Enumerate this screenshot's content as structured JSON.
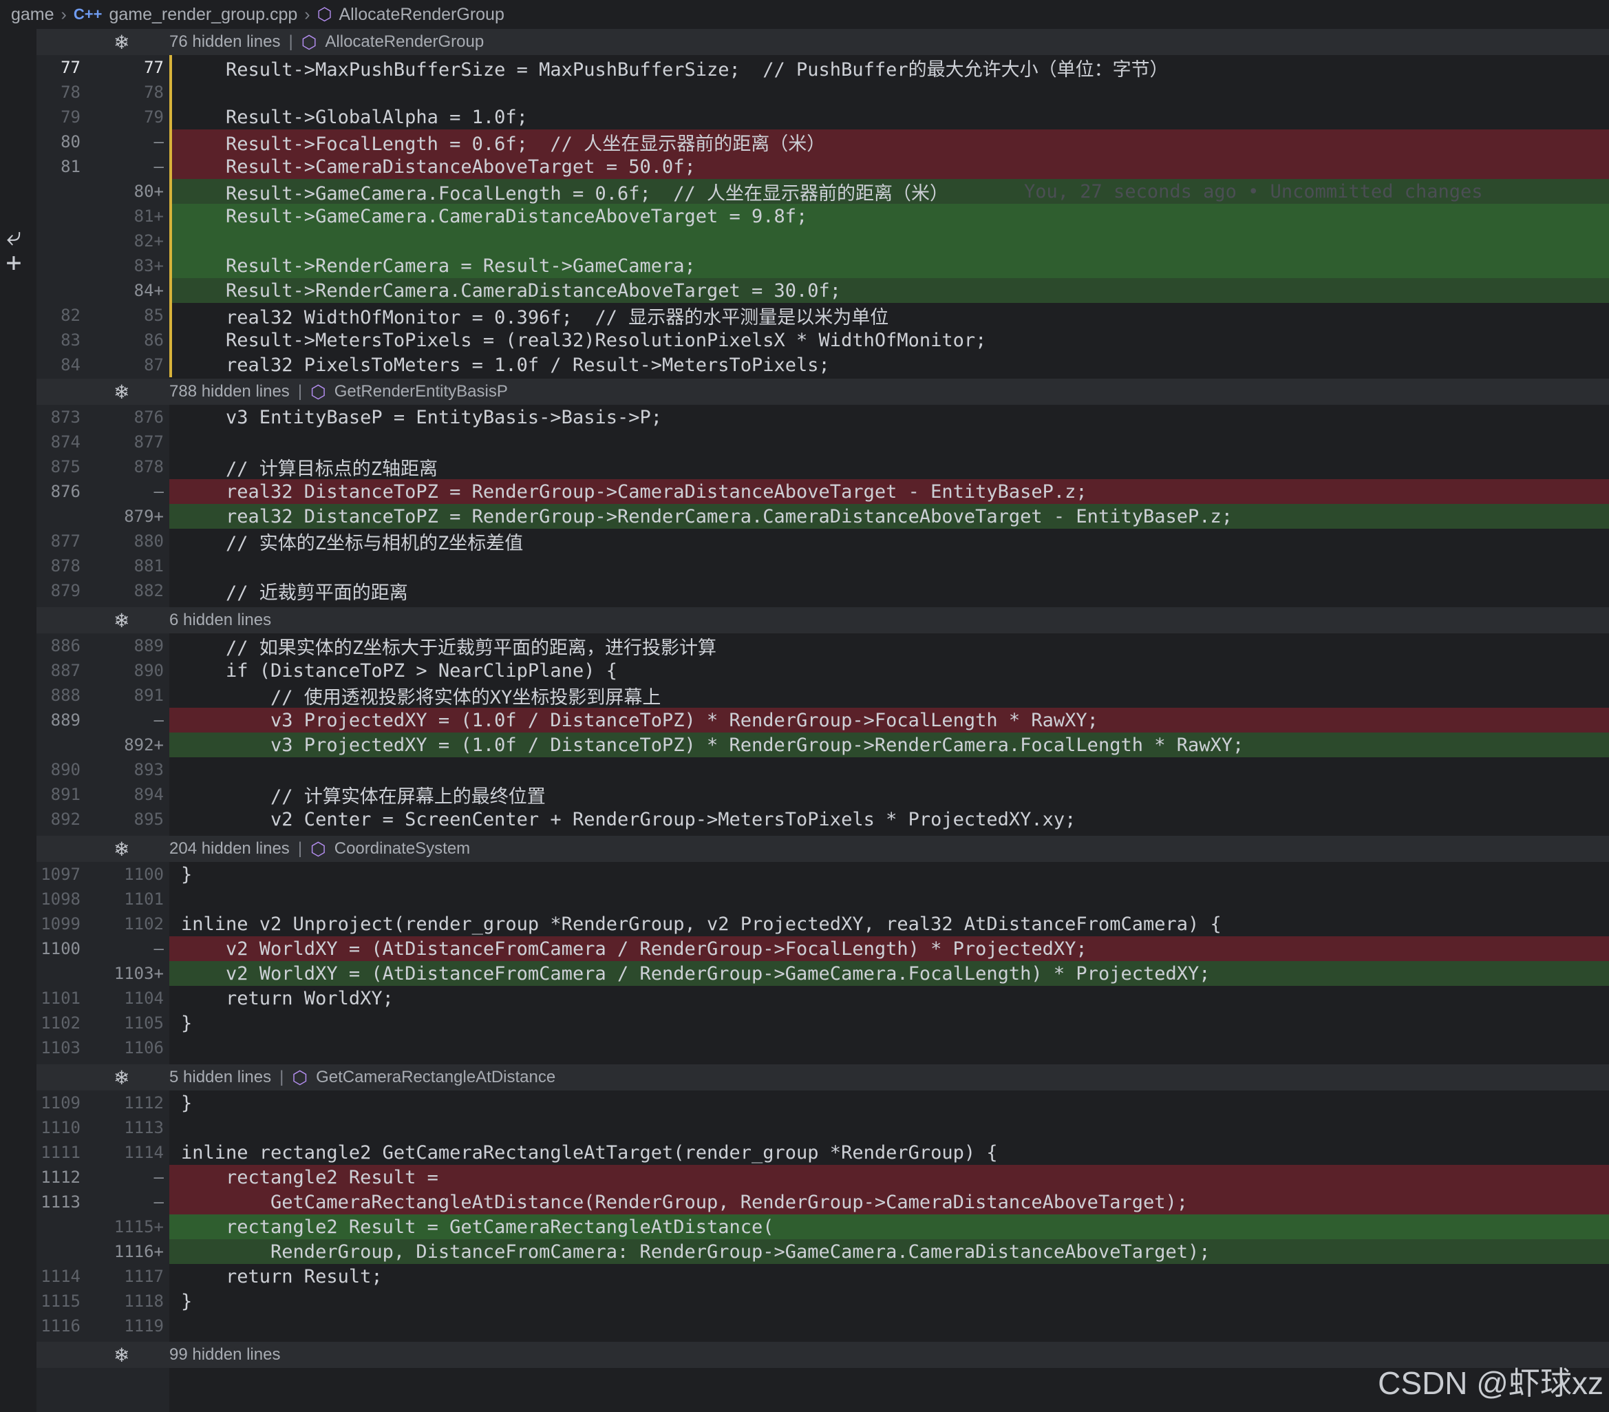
{
  "breadcrumb": {
    "folder": "game",
    "file_icon": "C++",
    "file": "game_render_group.cpp",
    "symbol": "AllocateRenderGroup"
  },
  "folds": [
    {
      "text": "76 hidden lines",
      "symbol": "AllocateRenderGroup"
    },
    {
      "text": "788 hidden lines",
      "symbol": "GetRenderEntityBasisP"
    },
    {
      "text": "6 hidden lines",
      "symbol": ""
    },
    {
      "text": "204 hidden lines",
      "symbol": "CoordinateSystem"
    },
    {
      "text": "5 hidden lines",
      "symbol": "GetCameraRectangleAtDistance"
    },
    {
      "text": "99 hidden lines",
      "symbol": ""
    }
  ],
  "lines": [
    {
      "old": "77",
      "new": "77",
      "type": "ctx",
      "text": "    Result->MaxPushBufferSize = MaxPushBufferSize;  // PushBuffer的最大允许大小（单位：字节）"
    },
    {
      "old": "78",
      "new": "78",
      "type": "ctx",
      "text": ""
    },
    {
      "old": "79",
      "new": "79",
      "type": "ctx",
      "text": "    Result->GlobalAlpha = 1.0f;"
    },
    {
      "old": "80",
      "new": "—",
      "type": "del",
      "text": "    Result->FocalLength = 0.6f;  // 人坐在显示器前的距离（米）"
    },
    {
      "old": "81",
      "new": "—",
      "type": "del",
      "text": "    Result->CameraDistanceAboveTarget = 50.0f;"
    },
    {
      "old": "",
      "new": "80+",
      "type": "add",
      "text": "    Result->GameCamera.FocalLength = 0.6f;  // 人坐在显示器前的距离（米）",
      "blame": "You, 27 seconds ago • Uncommitted changes"
    },
    {
      "old": "",
      "new": "81+",
      "type": "add-strong",
      "text": "    Result->GameCamera.CameraDistanceAboveTarget = 9.8f;"
    },
    {
      "old": "",
      "new": "82+",
      "type": "add-strong",
      "text": ""
    },
    {
      "old": "",
      "new": "83+",
      "type": "add-strong",
      "text": "    Result->RenderCamera = Result->GameCamera;"
    },
    {
      "old": "",
      "new": "84+",
      "type": "add",
      "text": "    Result->RenderCamera.CameraDistanceAboveTarget = 30.0f;"
    },
    {
      "old": "82",
      "new": "85",
      "type": "ctx",
      "text": "    real32 WidthOfMonitor = 0.396f;  // 显示器的水平测量是以米为单位"
    },
    {
      "old": "83",
      "new": "86",
      "type": "ctx",
      "text": "    Result->MetersToPixels = (real32)ResolutionPixelsX * WidthOfMonitor;"
    },
    {
      "old": "84",
      "new": "87",
      "type": "ctx",
      "text": "    real32 PixelsToMeters = 1.0f / Result->MetersToPixels;"
    },
    {
      "old": "873",
      "new": "876",
      "type": "ctx",
      "text": "    v3 EntityBaseP = EntityBasis->Basis->P;"
    },
    {
      "old": "874",
      "new": "877",
      "type": "ctx",
      "text": ""
    },
    {
      "old": "875",
      "new": "878",
      "type": "ctx",
      "text": "    // 计算目标点的Z轴距离"
    },
    {
      "old": "876",
      "new": "—",
      "type": "del",
      "text": "    real32 DistanceToPZ = RenderGroup->CameraDistanceAboveTarget - EntityBaseP.z;"
    },
    {
      "old": "",
      "new": "879+",
      "type": "add",
      "text": "    real32 DistanceToPZ = RenderGroup->RenderCamera.CameraDistanceAboveTarget - EntityBaseP.z;"
    },
    {
      "old": "877",
      "new": "880",
      "type": "ctx",
      "text": "    // 实体的Z坐标与相机的Z坐标差值"
    },
    {
      "old": "878",
      "new": "881",
      "type": "ctx",
      "text": ""
    },
    {
      "old": "879",
      "new": "882",
      "type": "ctx",
      "text": "    // 近裁剪平面的距离"
    },
    {
      "old": "886",
      "new": "889",
      "type": "ctx",
      "text": "    // 如果实体的Z坐标大于近裁剪平面的距离，进行投影计算"
    },
    {
      "old": "887",
      "new": "890",
      "type": "ctx",
      "text": "    if (DistanceToPZ > NearClipPlane) {"
    },
    {
      "old": "888",
      "new": "891",
      "type": "ctx",
      "text": "        // 使用透视投影将实体的XY坐标投影到屏幕上"
    },
    {
      "old": "889",
      "new": "—",
      "type": "del",
      "text": "        v3 ProjectedXY = (1.0f / DistanceToPZ) * RenderGroup->FocalLength * RawXY;"
    },
    {
      "old": "",
      "new": "892+",
      "type": "add",
      "text": "        v3 ProjectedXY = (1.0f / DistanceToPZ) * RenderGroup->RenderCamera.FocalLength * RawXY;"
    },
    {
      "old": "890",
      "new": "893",
      "type": "ctx",
      "text": ""
    },
    {
      "old": "891",
      "new": "894",
      "type": "ctx",
      "text": "        // 计算实体在屏幕上的最终位置"
    },
    {
      "old": "892",
      "new": "895",
      "type": "ctx",
      "text": "        v2 Center = ScreenCenter + RenderGroup->MetersToPixels * ProjectedXY.xy;"
    },
    {
      "old": "1097",
      "new": "1100",
      "type": "ctx",
      "text": "}"
    },
    {
      "old": "1098",
      "new": "1101",
      "type": "ctx",
      "text": ""
    },
    {
      "old": "1099",
      "new": "1102",
      "type": "ctx",
      "text": "inline v2 Unproject(render_group *RenderGroup, v2 ProjectedXY, real32 AtDistanceFromCamera) {"
    },
    {
      "old": "1100",
      "new": "—",
      "type": "del",
      "text": "    v2 WorldXY = (AtDistanceFromCamera / RenderGroup->FocalLength) * ProjectedXY;"
    },
    {
      "old": "",
      "new": "1103+",
      "type": "add",
      "text": "    v2 WorldXY = (AtDistanceFromCamera / RenderGroup->GameCamera.FocalLength) * ProjectedXY;"
    },
    {
      "old": "1101",
      "new": "1104",
      "type": "ctx",
      "text": "    return WorldXY;"
    },
    {
      "old": "1102",
      "new": "1105",
      "type": "ctx",
      "text": "}"
    },
    {
      "old": "1103",
      "new": "1106",
      "type": "ctx",
      "text": ""
    },
    {
      "old": "1109",
      "new": "1112",
      "type": "ctx",
      "text": "}"
    },
    {
      "old": "1110",
      "new": "1113",
      "type": "ctx",
      "text": ""
    },
    {
      "old": "1111",
      "new": "1114",
      "type": "ctx",
      "text": "inline rectangle2 GetCameraRectangleAtTarget(render_group *RenderGroup) {"
    },
    {
      "old": "1112",
      "new": "—",
      "type": "del",
      "text": "    rectangle2 Result ="
    },
    {
      "old": "1113",
      "new": "—",
      "type": "del",
      "text": "        GetCameraRectangleAtDistance(RenderGroup, RenderGroup->CameraDistanceAboveTarget);"
    },
    {
      "old": "",
      "new": "1115+",
      "type": "add-strong",
      "text": "    rectangle2 Result = GetCameraRectangleAtDistance("
    },
    {
      "old": "",
      "new": "1116+",
      "type": "add",
      "text": "        RenderGroup, DistanceFromCamera: RenderGroup->GameCamera.CameraDistanceAboveTarget);"
    },
    {
      "old": "1114",
      "new": "1117",
      "type": "ctx",
      "text": "    return Result;"
    },
    {
      "old": "1115",
      "new": "1118",
      "type": "ctx",
      "text": "}"
    },
    {
      "old": "1116",
      "new": "1119",
      "type": "ctx",
      "text": ""
    }
  ],
  "watermark": "CSDN @虾球xz",
  "colors": {
    "deleted": "#5a2129",
    "added": "#2c4a2c",
    "fold": "#2b2d31",
    "background": "#1e1f22",
    "accent": "#d7b23a"
  }
}
